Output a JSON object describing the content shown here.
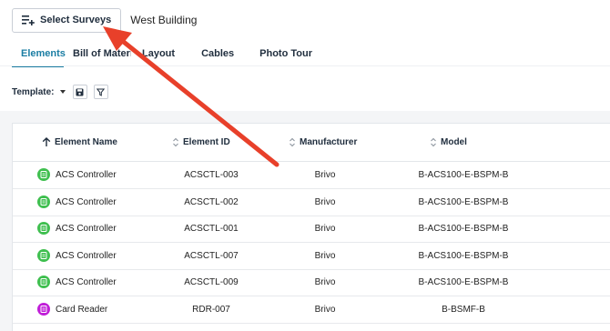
{
  "toolbar": {
    "select_surveys_label": "Select Surveys",
    "select_surveys_icon": "playlist-add-icon",
    "building_name": "West Building"
  },
  "tabs": [
    {
      "label": "Elements",
      "active": true
    },
    {
      "label": "Bill of Materials",
      "active": false
    },
    {
      "label": "Layout",
      "active": false
    },
    {
      "label": "Cables",
      "active": false
    },
    {
      "label": "Photo Tour",
      "active": false
    }
  ],
  "template": {
    "label": "Template:",
    "save_icon": "save-icon",
    "filter_icon": "filter-icon"
  },
  "table": {
    "columns": [
      {
        "label": "Element Name",
        "sort": "ascending"
      },
      {
        "label": "Element ID",
        "sort": "none"
      },
      {
        "label": "Manufacturer",
        "sort": "none"
      },
      {
        "label": "Model",
        "sort": "none"
      }
    ],
    "rows": [
      {
        "name": "ACS Controller",
        "id": "ACSCTL-003",
        "manufacturer": "Brivo",
        "model": "B-ACS100-E-BSPM-B",
        "icon_color": "#3fbf4f"
      },
      {
        "name": "ACS Controller",
        "id": "ACSCTL-002",
        "manufacturer": "Brivo",
        "model": "B-ACS100-E-BSPM-B",
        "icon_color": "#3fbf4f"
      },
      {
        "name": "ACS Controller",
        "id": "ACSCTL-001",
        "manufacturer": "Brivo",
        "model": "B-ACS100-E-BSPM-B",
        "icon_color": "#3fbf4f"
      },
      {
        "name": "ACS Controller",
        "id": "ACSCTL-007",
        "manufacturer": "Brivo",
        "model": "B-ACS100-E-BSPM-B",
        "icon_color": "#3fbf4f"
      },
      {
        "name": "ACS Controller",
        "id": "ACSCTL-009",
        "manufacturer": "Brivo",
        "model": "B-ACS100-E-BSPM-B",
        "icon_color": "#3fbf4f"
      },
      {
        "name": "Card Reader",
        "id": "RDR-007",
        "manufacturer": "Brivo",
        "model": "B-BSMF-B",
        "icon_color": "#c01ed8"
      }
    ]
  },
  "colors": {
    "accent": "#1a7da3",
    "annotation_arrow": "#e8402a"
  }
}
